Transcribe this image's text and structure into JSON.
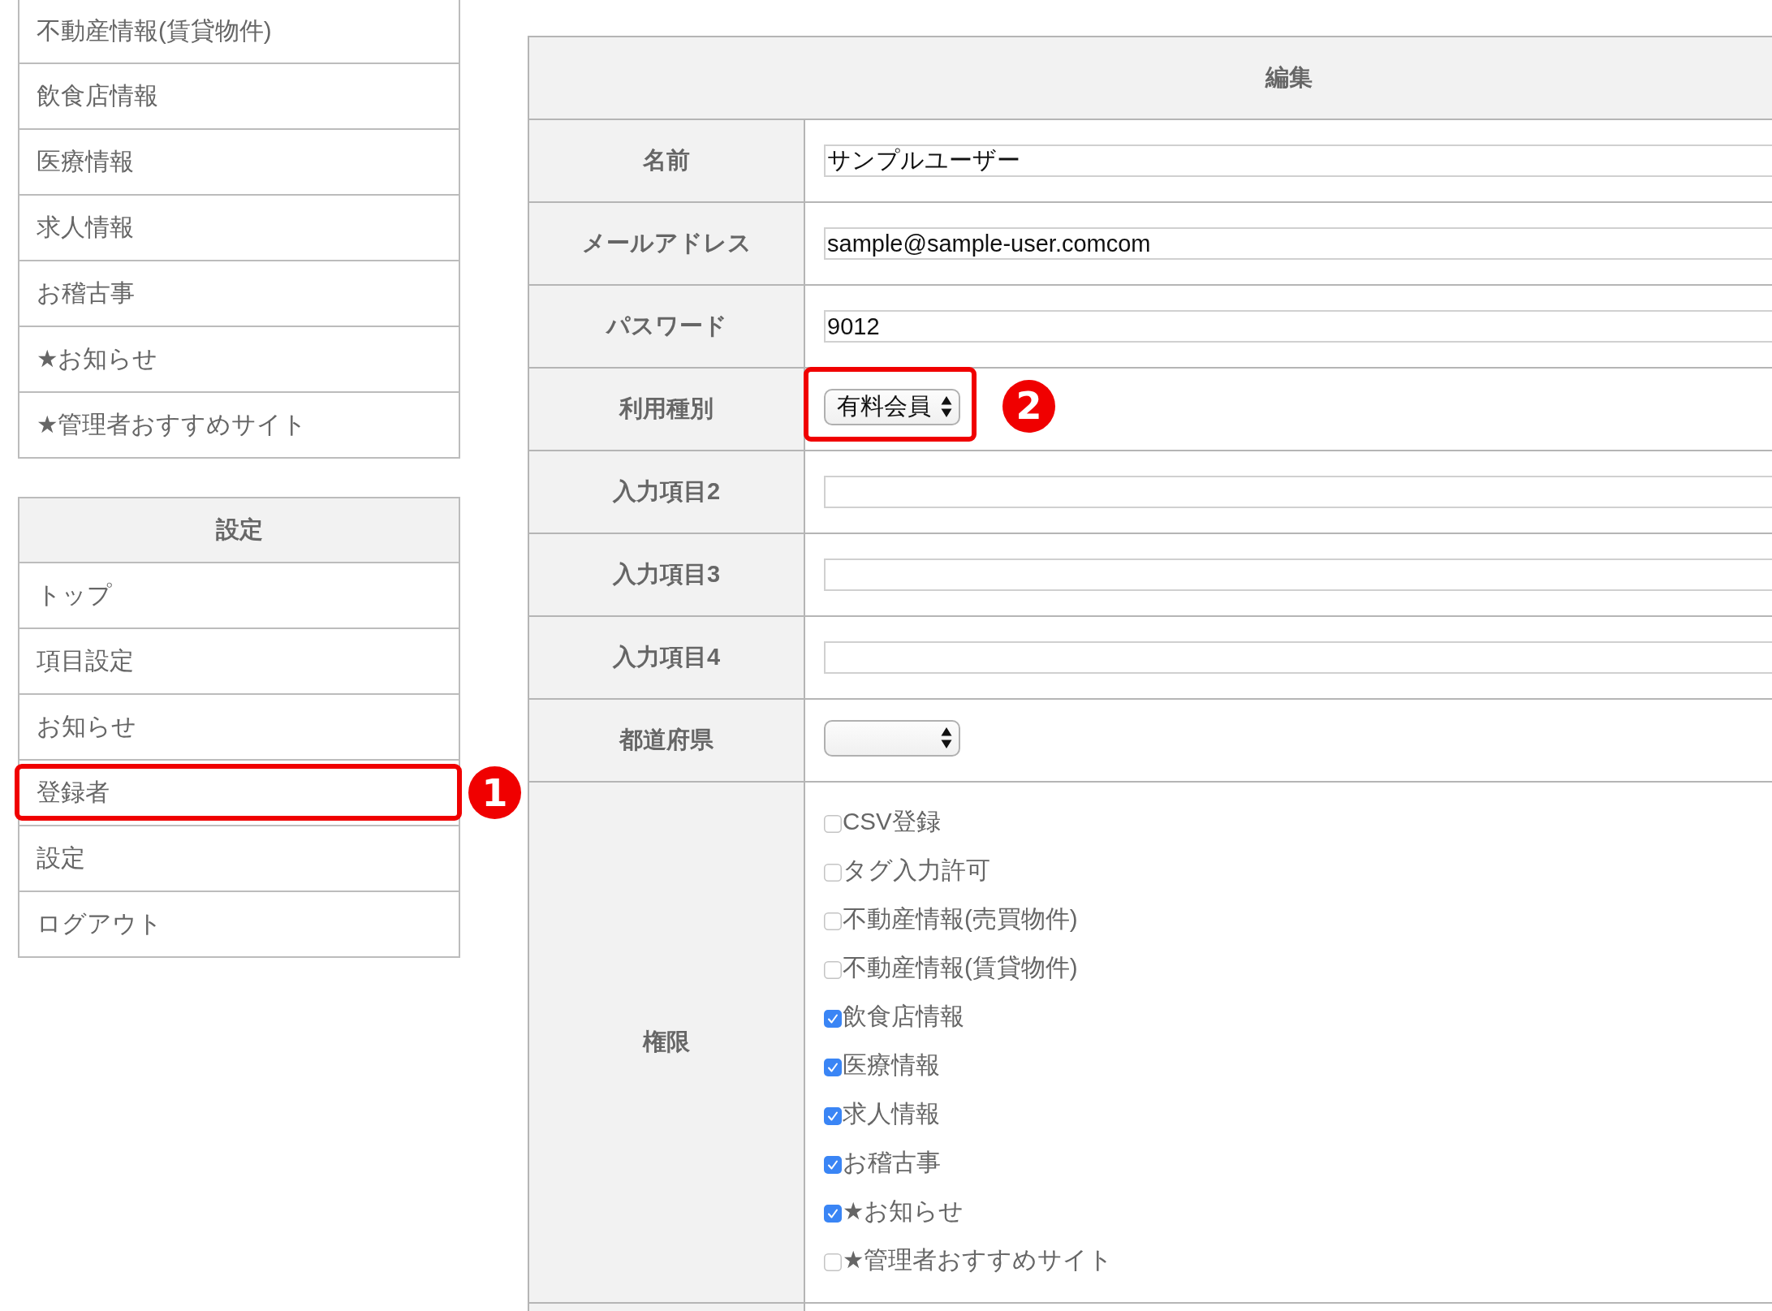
{
  "sidebar": {
    "menus": [
      {
        "items": [
          {
            "label": "不動産情報(賃貸物件)",
            "highlighted": false
          },
          {
            "label": "飲食店情報",
            "highlighted": false
          },
          {
            "label": "医療情報",
            "highlighted": false
          },
          {
            "label": "求人情報",
            "highlighted": false
          },
          {
            "label": "お稽古事",
            "highlighted": false
          },
          {
            "label": "★お知らせ",
            "highlighted": false
          },
          {
            "label": "★管理者おすすめサイト",
            "highlighted": false
          }
        ]
      },
      {
        "title": "設定",
        "items": [
          {
            "label": "トップ",
            "highlighted": false
          },
          {
            "label": "項目設定",
            "highlighted": false
          },
          {
            "label": "お知らせ",
            "highlighted": false
          },
          {
            "label": "登録者",
            "highlighted": true,
            "callout": "1"
          },
          {
            "label": "設定",
            "highlighted": false
          },
          {
            "label": "ログアウト",
            "highlighted": false
          }
        ]
      }
    ]
  },
  "form": {
    "title": "編集",
    "rows": [
      {
        "kind": "text",
        "label": "名前",
        "value": "サンプルユーザー",
        "highlighted": false
      },
      {
        "kind": "text",
        "label": "メールアドレス",
        "value": "sample@sample-user.comcom",
        "highlighted": false
      },
      {
        "kind": "text",
        "label": "パスワード",
        "value": "9012",
        "highlighted": false
      },
      {
        "kind": "select",
        "label": "利用種別",
        "value": "有料会員",
        "highlighted": true,
        "callout": "2"
      },
      {
        "kind": "text",
        "label": "入力項目2",
        "highlighted": false
      },
      {
        "kind": "text",
        "label": "入力項目3",
        "highlighted": false
      },
      {
        "kind": "text",
        "label": "入力項目4",
        "highlighted": false
      },
      {
        "kind": "select",
        "label": "都道府県",
        "highlighted": false
      },
      {
        "kind": "checkboxes",
        "label": "権限",
        "highlighted": false,
        "options": [
          {
            "label": "CSV登録",
            "checked": false
          },
          {
            "label": "タグ入力許可",
            "checked": false
          },
          {
            "label": "不動産情報(売買物件)",
            "checked": false
          },
          {
            "label": "不動産情報(賃貸物件)",
            "checked": false
          },
          {
            "label": "飲食店情報",
            "checked": true
          },
          {
            "label": "医療情報",
            "checked": true
          },
          {
            "label": "求人情報",
            "checked": true
          },
          {
            "label": "お稽古事",
            "checked": true
          },
          {
            "label": "★お知らせ",
            "checked": true
          },
          {
            "label": "★管理者おすすめサイト",
            "checked": false
          }
        ]
      }
    ]
  }
}
